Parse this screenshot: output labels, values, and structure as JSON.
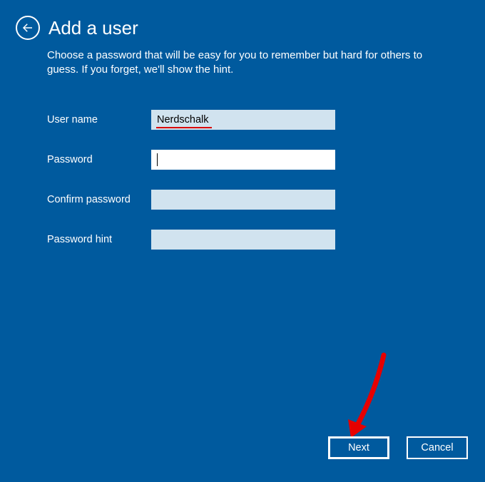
{
  "header": {
    "title": "Add a user"
  },
  "description": "Choose a password that will be easy for you to remember but hard for others to guess. If you forget, we'll show the hint.",
  "form": {
    "username_label": "User name",
    "username_value": "Nerdschalk",
    "password_label": "Password",
    "password_value": "",
    "confirm_label": "Confirm password",
    "confirm_value": "",
    "hint_label": "Password hint",
    "hint_value": ""
  },
  "buttons": {
    "next": "Next",
    "cancel": "Cancel"
  }
}
